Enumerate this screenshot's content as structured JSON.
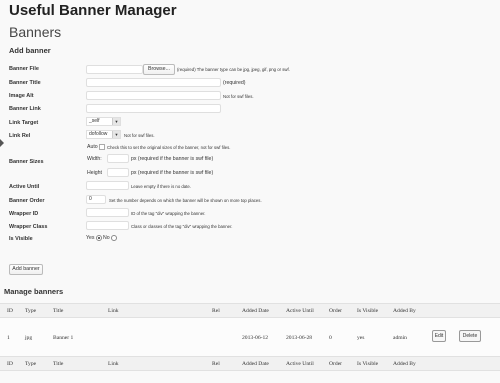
{
  "app_title": "Useful Banner Manager",
  "page_title": "Banners",
  "section_title": "Add banner",
  "form": {
    "banner_file": {
      "label": "Banner File",
      "browse": "Browse...",
      "hint": "(required) The banner type can be jpg, jpeg, gif, png or swf."
    },
    "banner_title": {
      "label": "Banner Title",
      "hint": "(required)"
    },
    "image_alt": {
      "label": "Image Alt",
      "hint": "Not for swf files."
    },
    "banner_link": {
      "label": "Banner Link"
    },
    "link_target": {
      "label": "Link Target",
      "value": "_self"
    },
    "link_rel": {
      "label": "Link Rel",
      "value": "dofollow",
      "hint": "Not for swf files."
    },
    "auto": {
      "label": "Auto",
      "hint": "Check this to set the original sizes of the banner, not for swf files."
    },
    "banner_sizes": {
      "label": "Banner Sizes",
      "width_label": "Width:",
      "width_hint": "px (required if the banner is swf file)",
      "height_label": "Height",
      "height_hint": "px (required if the banner is swf file)"
    },
    "active_until": {
      "label": "Active Until",
      "hint": "Leave empty if there is no date."
    },
    "banner_order": {
      "label": "Banner Order",
      "value": "0",
      "hint": "Set the number depends on which the banner will be shown on more top places."
    },
    "wrapper_id": {
      "label": "Wrapper ID",
      "hint": "ID of the tag \"div\" wrapping the banner."
    },
    "wrapper_class": {
      "label": "Wrapper Class",
      "hint": "Class or classes of the tag \"div\" wrapping the banner."
    },
    "is_visible": {
      "label": "Is Visible",
      "yes": "Yes",
      "no": "No",
      "selected": "yes"
    },
    "submit": "Add banner"
  },
  "manage_title": "Manage banners",
  "table": {
    "columns": [
      "ID",
      "Type",
      "Title",
      "Link",
      "Rel",
      "Added Date",
      "Active Until",
      "Order",
      "Is Visible",
      "Added By"
    ],
    "rows": [
      {
        "id": "1",
        "type": "jpg",
        "title": "Banner 1",
        "link": "",
        "rel": "",
        "added_date": "2013-06-12",
        "active_until": "2013-06-28",
        "order": "0",
        "is_visible": "yes",
        "added_by": "admin",
        "edit": "Edit",
        "delete": "Delete"
      }
    ]
  }
}
